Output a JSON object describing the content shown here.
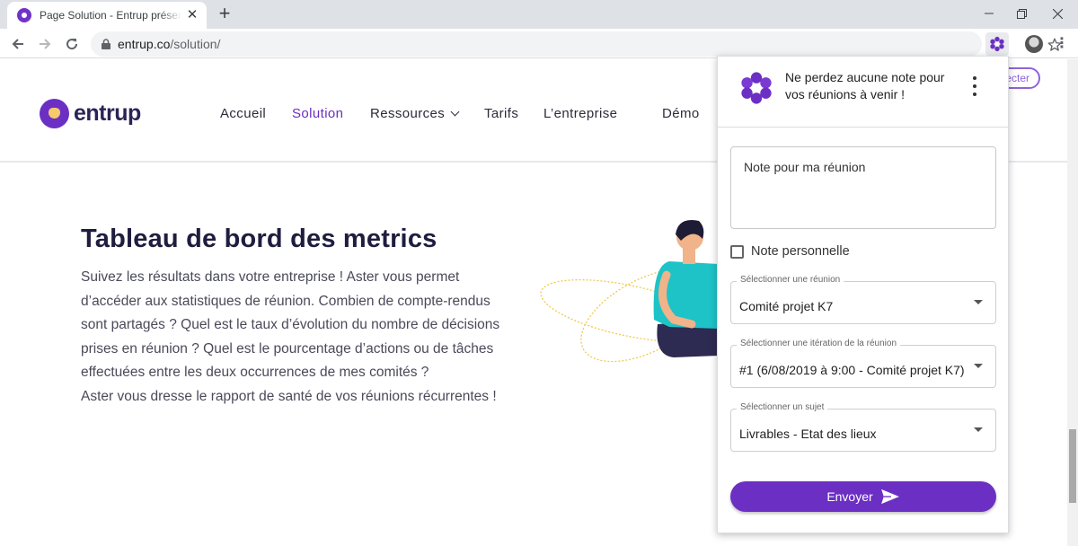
{
  "browser": {
    "tab_title": "Page Solution - Entrup présente Aster",
    "url_domain": "entrup.co",
    "url_path": "/solution/"
  },
  "site": {
    "logo_text": "entrup",
    "nav": [
      "Accueil",
      "Solution",
      "Ressources",
      "Tarifs",
      "L’entreprise",
      "Démo"
    ],
    "active_nav": "Solution",
    "connect_label": "ecter",
    "hero_title": "Tableau de bord des metrics",
    "hero_lines": [
      "Suivez les résultats dans votre entreprise ! Aster vous permet",
      "d’accéder aux statistiques de réunion. Combien de compte-rendus",
      "sont partagés ? Quel est le taux d’évolution du nombre de décisions",
      "prises en réunion ? Quel est le pourcentage d’actions ou de tâches",
      "effectuées entre les deux occurrences de mes comités ?",
      "Aster vous dresse le rapport de santé de vos réunions récurrentes !"
    ]
  },
  "popup": {
    "message": "Ne perdez aucune note pour vos réunions à venir !",
    "note_placeholder": "Note pour ma réunion",
    "checkbox_label": "Note personnelle",
    "checkbox_checked": false,
    "fields": [
      {
        "label": "Sélectionner une réunion",
        "value": "Comité projet K7"
      },
      {
        "label": "Sélectionner une itération de la réunion",
        "value": "#1 (6/08/2019 à 9:00 - Comité projet K7)"
      },
      {
        "label": "Sélectionner un sujet",
        "value": "Livrables - Etat des lieux"
      }
    ],
    "send_label": "Envoyer"
  },
  "colors": {
    "brand_purple": "#6c2fc3",
    "tab_bar": "#dee1e6"
  }
}
